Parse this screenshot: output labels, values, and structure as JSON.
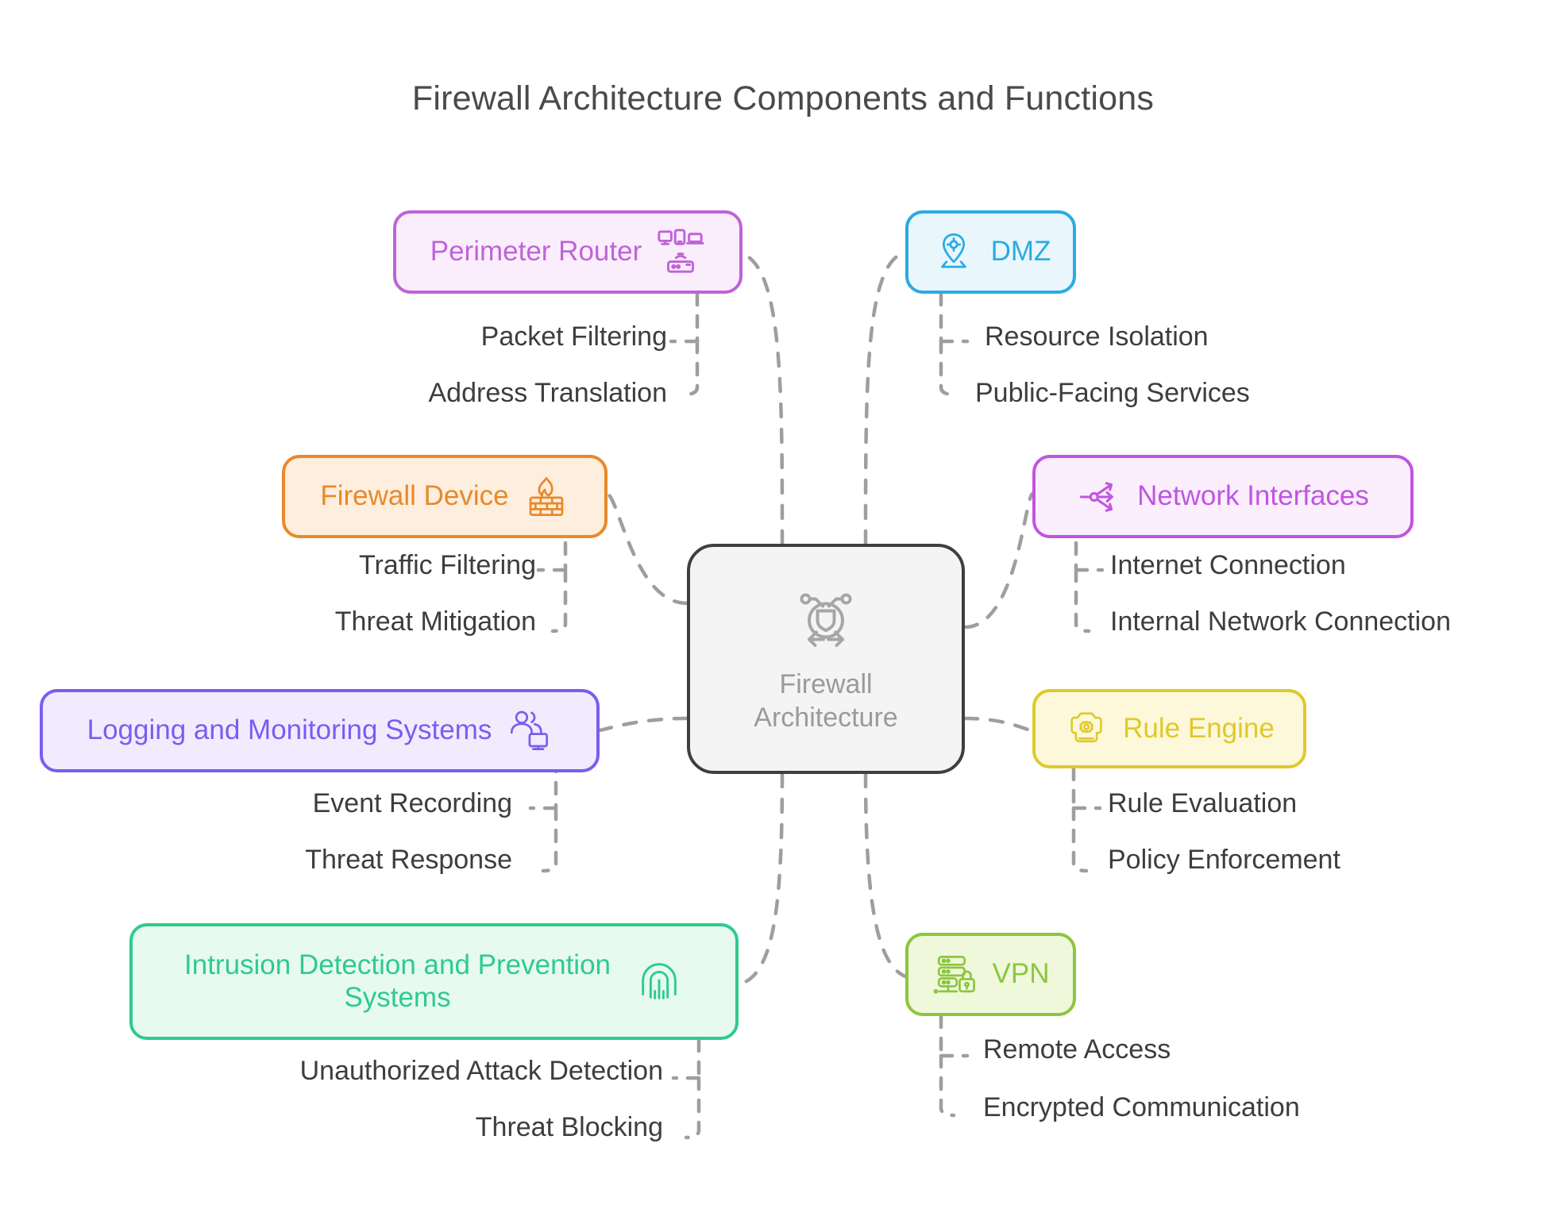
{
  "title": "Firewall Architecture Components and Functions",
  "center": {
    "label": "Firewall\nArchitecture",
    "icon": "shield-network-icon",
    "bg": "#f4f4f4",
    "border": "#3f3f3f",
    "text_color": "#9a9a9a"
  },
  "colors": {
    "connector": "#9e9e9e",
    "leaf_text": "#3d3d3d",
    "title_text": "#4a4a4a",
    "background": "#ffffff"
  },
  "branches": [
    {
      "id": "perimeter-router",
      "label": "Perimeter Router",
      "icon": "router-devices-icon",
      "color": "#bf63d8",
      "bg": "#faeefd",
      "side": "left",
      "leaves": [
        "Packet Filtering",
        "Address Translation"
      ]
    },
    {
      "id": "dmz",
      "label": "DMZ",
      "icon": "location-pin-target-icon",
      "color": "#2aabe2",
      "bg": "#e9f7fd",
      "side": "right",
      "leaves": [
        "Resource Isolation",
        "Public-Facing Services"
      ]
    },
    {
      "id": "firewall-device",
      "label": "Firewall Device",
      "icon": "brick-wall-flame-icon",
      "color": "#e8892b",
      "bg": "#fdeedd",
      "side": "left",
      "leaves": [
        "Traffic Filtering",
        "Threat Mitigation"
      ]
    },
    {
      "id": "network-interfaces",
      "label": "Network Interfaces",
      "icon": "split-arrows-icon",
      "color": "#c055e0",
      "bg": "#fbeefd",
      "side": "right",
      "leaves": [
        "Internet Connection",
        "Internal Network Connection"
      ]
    },
    {
      "id": "logging-and-monitoring-systems",
      "label": "Logging and Monitoring Systems",
      "icon": "users-monitor-icon",
      "color": "#7c5cf0",
      "bg": "#f0ecfe",
      "side": "left",
      "leaves": [
        "Event Recording",
        "Threat Response"
      ]
    },
    {
      "id": "rule-engine",
      "label": "Rule Engine",
      "icon": "engine-gear-icon",
      "color": "#e0c92a",
      "bg": "#fcf8d9",
      "side": "right",
      "leaves": [
        "Rule Evaluation",
        "Policy Enforcement"
      ]
    },
    {
      "id": "intrusion-detection-and-prevention-systems",
      "label": "Intrusion Detection and Prevention\nSystems",
      "icon": "fingerprint-icon",
      "color": "#2ecb8d",
      "bg": "#e7faf1",
      "side": "left",
      "leaves": [
        "Unauthorized Attack Detection",
        "Threat Blocking"
      ]
    },
    {
      "id": "vpn",
      "label": "VPN",
      "icon": "server-lock-icon",
      "color": "#8cc63e",
      "bg": "#f0f8dc",
      "side": "right",
      "leaves": [
        "Remote Access",
        "Encrypted Communication"
      ]
    }
  ]
}
